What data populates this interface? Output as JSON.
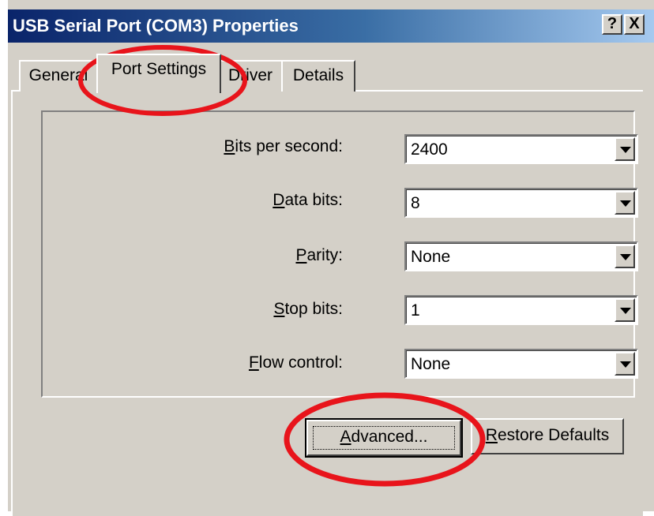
{
  "window": {
    "title": "USB Serial Port (COM3) Properties",
    "help_label": "?",
    "close_label": "X"
  },
  "tabs": [
    {
      "label": "General",
      "selected": false
    },
    {
      "label": "Port Settings",
      "selected": true
    },
    {
      "label": "Driver",
      "selected": false
    },
    {
      "label": "Details",
      "selected": false
    }
  ],
  "settings": [
    {
      "label_accel": "B",
      "label_rest": "its per second:",
      "value": "2400"
    },
    {
      "label_accel": "D",
      "label_rest": "ata bits:",
      "value": "8"
    },
    {
      "label_accel": "P",
      "label_rest": "arity:",
      "value": "None"
    },
    {
      "label_accel": "S",
      "label_rest": "top bits:",
      "value": "1"
    },
    {
      "label_accel": "F",
      "label_rest": "low control:",
      "value": "None"
    }
  ],
  "buttons": {
    "advanced_accel": "A",
    "advanced_rest": "dvanced...",
    "restore_accel": "R",
    "restore_rest": "estore Defaults"
  },
  "colors": {
    "annotation": "#e8141b",
    "title_bar_start": "#0a246a",
    "dialog_face": "#d4d0c8"
  }
}
